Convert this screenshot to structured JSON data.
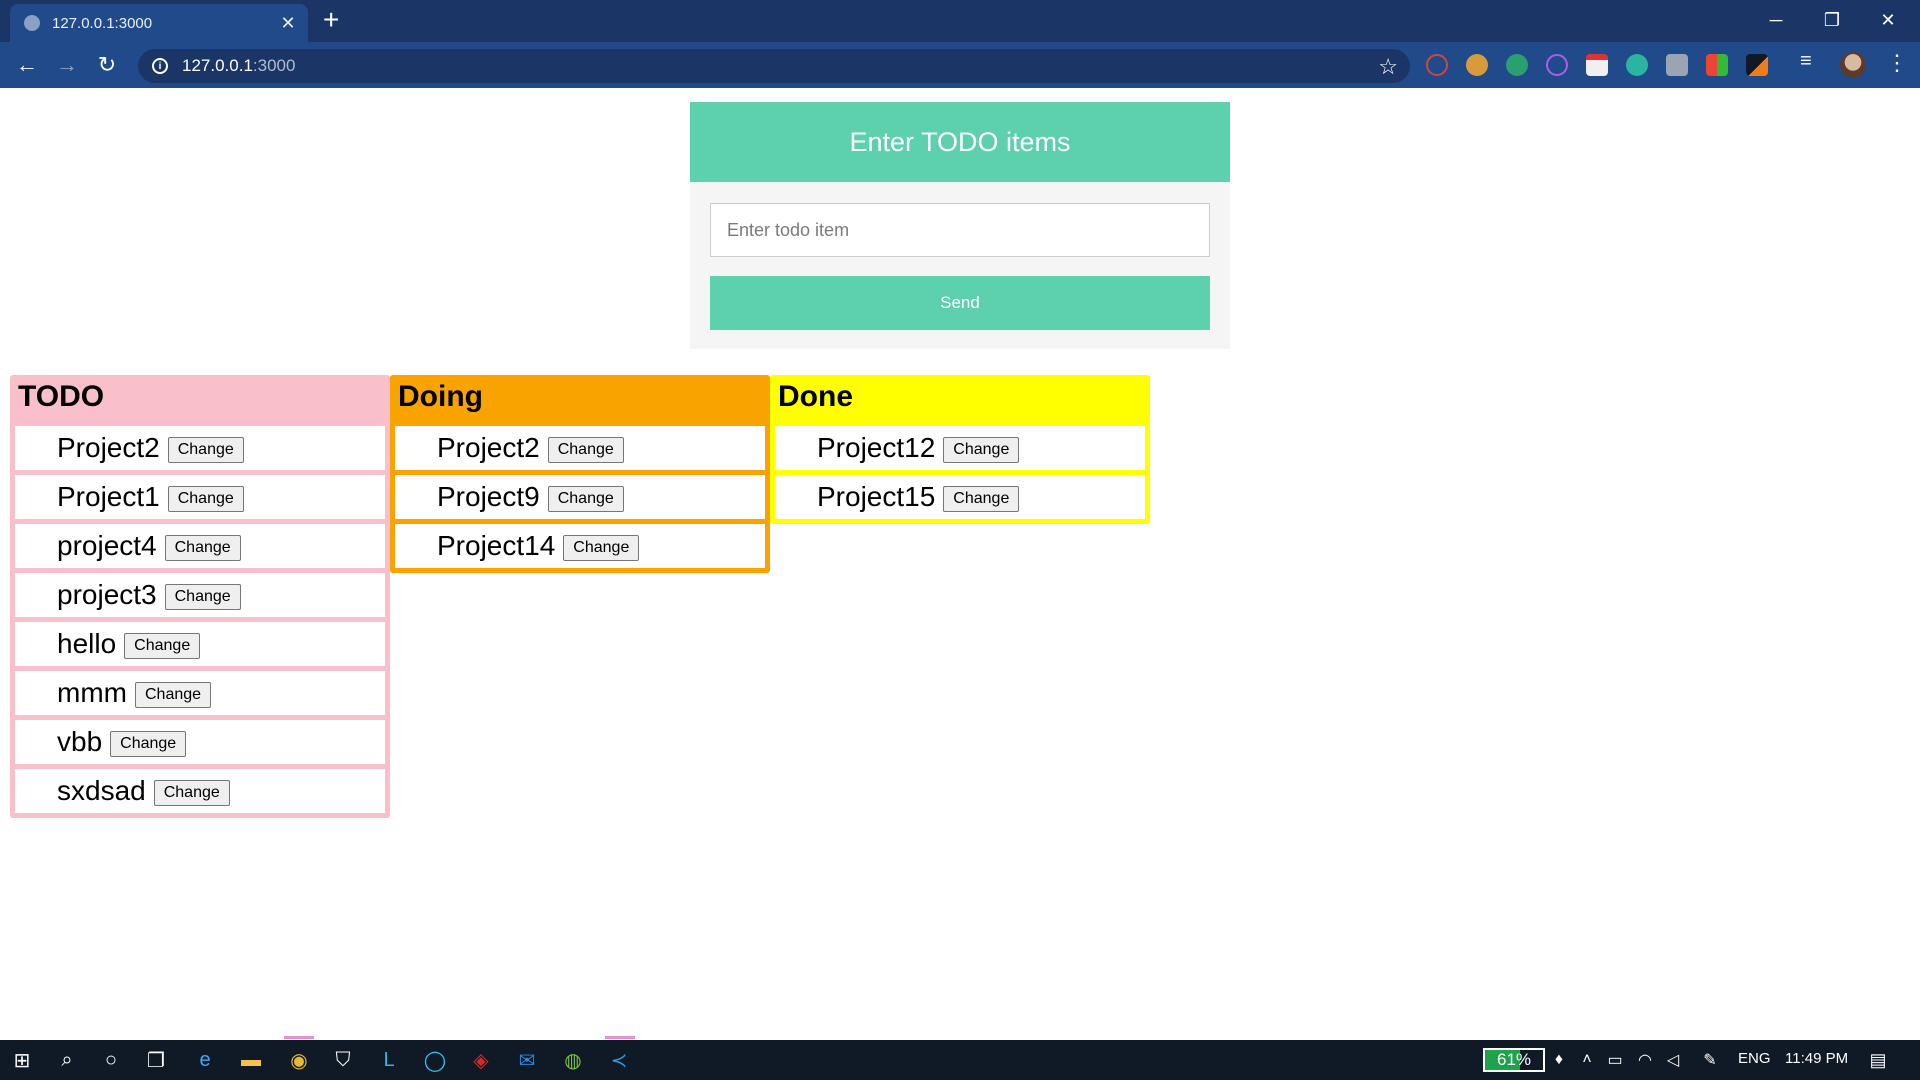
{
  "browser": {
    "tab_title": "127.0.0.1:3000",
    "tab_close": "✕",
    "new_tab": "+",
    "url_host": "127.0.0.1",
    "url_port": ":3000",
    "window_minimize": "─",
    "window_restore": "❐",
    "window_close": "✕"
  },
  "form": {
    "header": "Enter TODO items",
    "input_placeholder": "Enter todo item",
    "input_value": "",
    "send_label": "Send"
  },
  "columns": [
    {
      "title": "TODO",
      "color": "#f9c0cb",
      "items": [
        {
          "name": "Project2",
          "button": "Change"
        },
        {
          "name": "Project1",
          "button": "Change"
        },
        {
          "name": "project4",
          "button": "Change"
        },
        {
          "name": "project3",
          "button": "Change"
        },
        {
          "name": "hello",
          "button": "Change"
        },
        {
          "name": "mmm",
          "button": "Change"
        },
        {
          "name": "vbb",
          "button": "Change"
        },
        {
          "name": "sxdsad",
          "button": "Change"
        }
      ]
    },
    {
      "title": "Doing",
      "color": "#f9a300",
      "items": [
        {
          "name": "Project2",
          "button": "Change"
        },
        {
          "name": "Project9",
          "button": "Change"
        },
        {
          "name": "Project14",
          "button": "Change"
        }
      ]
    },
    {
      "title": "Done",
      "color": "#ffff00",
      "items": [
        {
          "name": "Project12",
          "button": "Change"
        },
        {
          "name": "Project15",
          "button": "Change"
        }
      ]
    }
  ],
  "taskbar": {
    "battery_percent": "61%",
    "battery_level": 0.61,
    "language": "ENG",
    "time": "11:49 PM"
  },
  "colors": {
    "accent": "#5dd0ad",
    "chrome_dark": "#1b3666",
    "chrome_toolbar": "#214a8a"
  }
}
